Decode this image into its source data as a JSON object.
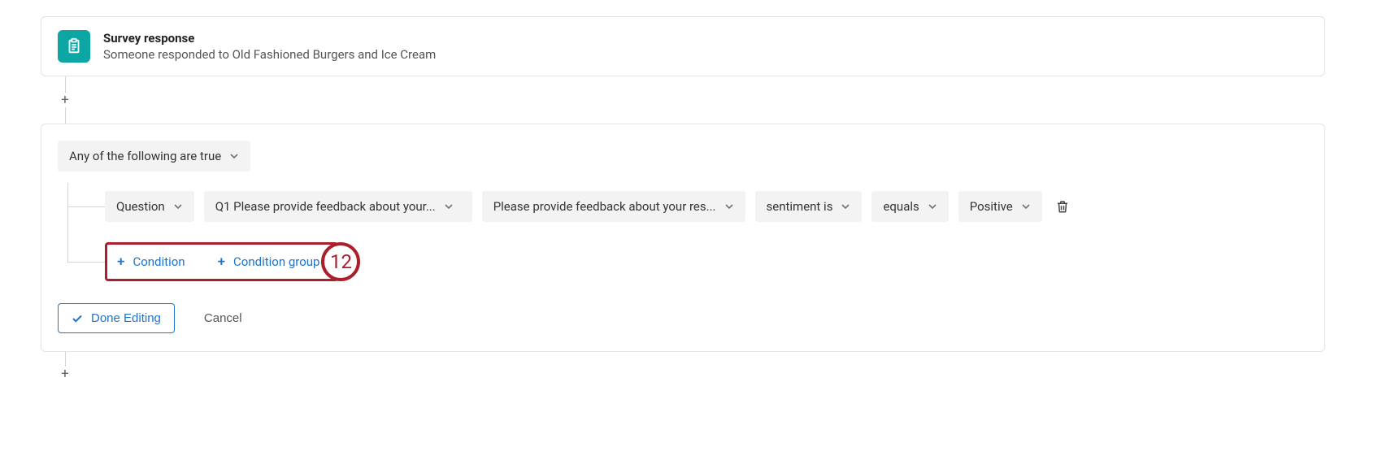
{
  "trigger": {
    "icon": "clipboard-icon",
    "title": "Survey response",
    "subtitle": "Someone responded to Old Fashioned Burgers and Ice Cream"
  },
  "condition_block": {
    "match_mode": "Any of the following are true",
    "rows": [
      {
        "field_type": "Question",
        "question": "Q1 Please provide feedback about your...",
        "sub_question": "Please provide feedback about your res...",
        "attribute": "sentiment is",
        "operator": "equals",
        "value": "Positive"
      }
    ],
    "add_condition_label": "Condition",
    "add_group_label": "Condition group",
    "callout_number": "12"
  },
  "footer": {
    "done_label": "Done Editing",
    "cancel_label": "Cancel"
  }
}
